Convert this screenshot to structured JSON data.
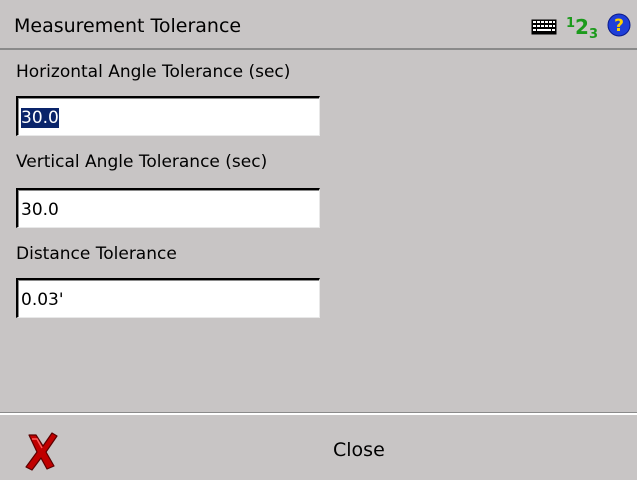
{
  "window": {
    "title": "Measurement Tolerance",
    "input_mode": {
      "sup": "1",
      "main": "2",
      "sub": "3"
    },
    "icons": [
      "keyboard-icon",
      "input-mode-icon",
      "help-icon"
    ]
  },
  "fields": {
    "horizontal": {
      "label": "Horizontal Angle Tolerance (sec)",
      "value": "30.0",
      "selected": true
    },
    "vertical": {
      "label": "Vertical Angle Tolerance (sec)",
      "value": "30.0"
    },
    "distance": {
      "label": "Distance Tolerance",
      "value": "0.03'"
    }
  },
  "footer": {
    "close_label": "Close"
  },
  "colors": {
    "background": "#c8c5c5",
    "selection": "#0a246a",
    "close_icon": "#c00000",
    "input_mode": "#1c9a1c",
    "help": "#1f3fd8"
  }
}
